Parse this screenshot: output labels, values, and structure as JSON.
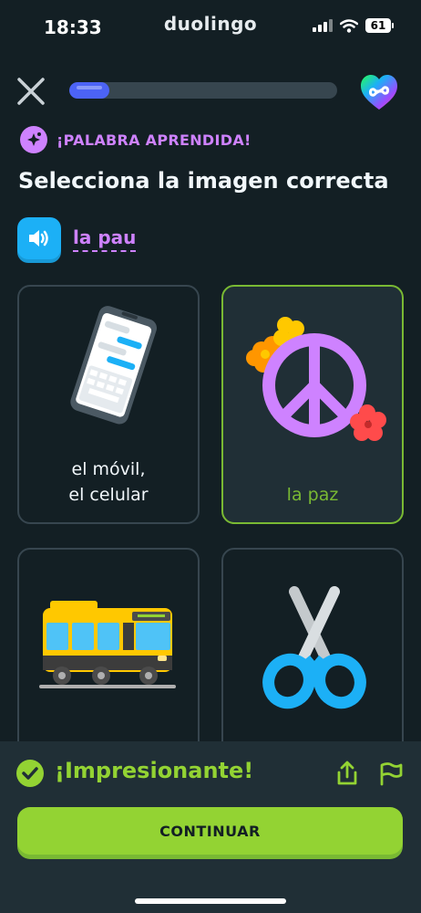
{
  "status_bar": {
    "time": "18:33",
    "app_name": "duolingo",
    "battery": "61"
  },
  "progress": {
    "fraction": 0.15
  },
  "badge": {
    "label": "¡PALABRA APRENDIDA!",
    "icon": "sparkle-icon"
  },
  "instruction": "Selecciona la imagen correcta",
  "audio": {
    "word": "la pau",
    "icon": "speaker-icon"
  },
  "choices": [
    {
      "label_line1": "el móvil,",
      "label_line2": "el celular",
      "icon": "phone-icon",
      "selected": false
    },
    {
      "label_line1": "la paz",
      "label_line2": "",
      "icon": "peace-sign-icon",
      "selected": true
    },
    {
      "label_line1": "",
      "label_line2": "",
      "icon": "bus-icon",
      "selected": false
    },
    {
      "label_line1": "",
      "label_line2": "",
      "icon": "scissors-icon",
      "selected": false
    }
  ],
  "feedback": {
    "message": "¡Impresionante!",
    "continue_label": "CONTINUAR"
  },
  "colors": {
    "background": "#131f24",
    "accent_green": "#93d333",
    "purple": "#ce82ff",
    "blue": "#1cb0f6",
    "progress": "#4c63f5"
  }
}
